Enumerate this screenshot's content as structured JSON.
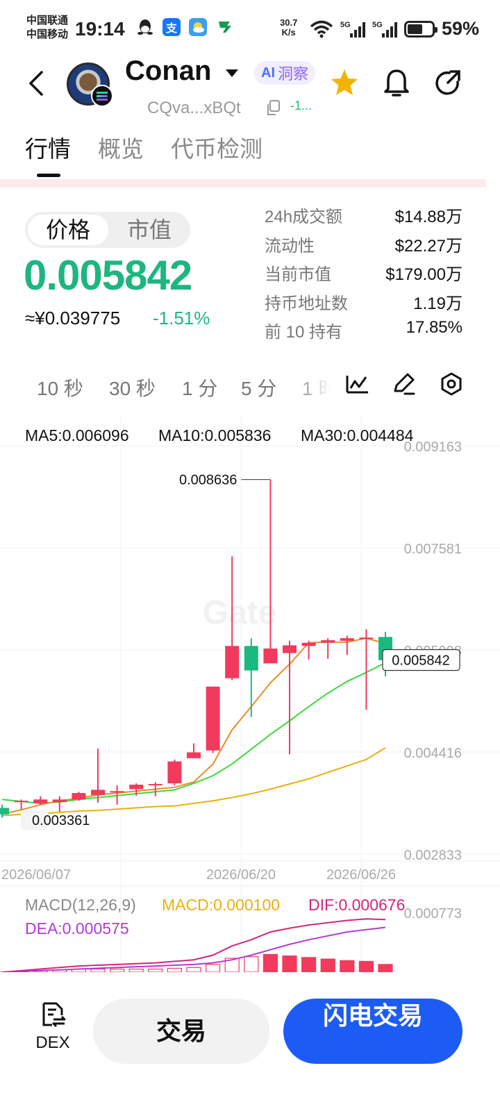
{
  "status_bar": {
    "carrier_1": "中国联通",
    "carrier_2": "中国移动",
    "time": "19:14",
    "net_speed_value": "30.7",
    "net_speed_unit": "K/s",
    "battery": "59%",
    "battery_level": 0.59
  },
  "header": {
    "coin_name": "Conan",
    "ai_tag": "洞察",
    "ai_prefix": "AI",
    "address": "CQva...xBQt",
    "address_change": "-1...",
    "favorite_color": "#f5b301"
  },
  "tabs": [
    "行情",
    "概览",
    "代币检测"
  ],
  "price_panel": {
    "toggle": [
      "价格",
      "市值"
    ],
    "price": "0.005842",
    "cny_price": "≈¥0.039775",
    "change_pct": "-1.51%",
    "stats": [
      {
        "label": "24h成交额",
        "value": "$14.88万"
      },
      {
        "label": "流动性",
        "value": "$22.27万"
      },
      {
        "label": "当前市值",
        "value": "$179.00万"
      },
      {
        "label": "持币地址数",
        "value": "1.19万"
      },
      {
        "label": "前 10 持有",
        "value": "17.85%"
      }
    ]
  },
  "intervals": [
    "10 秒",
    "30 秒",
    "1 分",
    "5 分",
    "1 时"
  ],
  "chart": {
    "ma5": "MA5:0.006096",
    "ma10": "MA10:0.005836",
    "ma30": "MA30:0.004484",
    "watermark": "Gate",
    "high_label": "0.008636",
    "low_label": "0.003361",
    "current_label": "0.005842",
    "colors": {
      "up": "#f23a5d",
      "down": "#1ab980",
      "ma5": "#f08a24",
      "ma10": "#3ed93c",
      "ma30": "#e8b012"
    }
  },
  "chart_data": {
    "type": "candlestick",
    "price_axis": {
      "ticks": [
        "0.009163",
        "0.007581",
        "0.005998",
        "0.004416",
        "0.002833"
      ],
      "range": [
        0.002833,
        0.009163
      ]
    },
    "x_tick_labels": [
      "2026/06/07",
      "2026/06/20",
      "2026/06/26"
    ],
    "candles": [
      {
        "o": 0.00355,
        "c": 0.00345,
        "h": 0.0036,
        "l": 0.0034
      },
      {
        "o": 0.00364,
        "c": 0.00366,
        "h": 0.00368,
        "l": 0.00352
      },
      {
        "o": 0.00362,
        "c": 0.00368,
        "h": 0.00373,
        "l": 0.0036
      },
      {
        "o": 0.00364,
        "c": 0.00368,
        "h": 0.00373,
        "l": 0.00349
      },
      {
        "o": 0.00368,
        "c": 0.00378,
        "h": 0.0038,
        "l": 0.00366
      },
      {
        "o": 0.00375,
        "c": 0.00383,
        "h": 0.00447,
        "l": 0.00363
      },
      {
        "o": 0.0038,
        "c": 0.00381,
        "h": 0.0039,
        "l": 0.0036
      },
      {
        "o": 0.00384,
        "c": 0.00391,
        "h": 0.00393,
        "l": 0.00374
      },
      {
        "o": 0.00391,
        "c": 0.00392,
        "h": 0.00395,
        "l": 0.00373
      },
      {
        "o": 0.00393,
        "c": 0.00427,
        "h": 0.0043,
        "l": 0.0039
      },
      {
        "o": 0.00432,
        "c": 0.00441,
        "h": 0.00455,
        "l": 0.00432
      },
      {
        "o": 0.00444,
        "c": 0.00543,
        "h": 0.00543,
        "l": 0.0044
      },
      {
        "o": 0.00556,
        "c": 0.00606,
        "h": 0.00745,
        "l": 0.00553
      },
      {
        "o": 0.00606,
        "c": 0.00568,
        "h": 0.00618,
        "l": 0.00496
      },
      {
        "o": 0.00579,
        "c": 0.00602,
        "h": 0.00864,
        "l": 0.00579
      },
      {
        "o": 0.00595,
        "c": 0.00607,
        "h": 0.00614,
        "l": 0.00438
      },
      {
        "o": 0.00606,
        "c": 0.00611,
        "h": 0.00614,
        "l": 0.00585
      },
      {
        "o": 0.00611,
        "c": 0.00615,
        "h": 0.00618,
        "l": 0.00586
      },
      {
        "o": 0.00614,
        "c": 0.00618,
        "h": 0.00622,
        "l": 0.00592
      },
      {
        "o": 0.00617,
        "c": 0.00619,
        "h": 0.00632,
        "l": 0.00507
      },
      {
        "o": 0.0062,
        "c": 0.00584,
        "h": 0.00628,
        "l": 0.00559
      }
    ],
    "ma5": [
      0.00345,
      0.00352,
      0.0036,
      0.00366,
      0.0037,
      0.00375,
      0.00378,
      0.00381,
      0.00384,
      0.00387,
      0.00395,
      0.00423,
      0.00476,
      0.00512,
      0.00549,
      0.00578,
      0.00611,
      0.00612,
      0.00612,
      0.00618,
      0.0061
    ],
    "ma10": [
      0.00368,
      0.00365,
      0.00362,
      0.00364,
      0.00368,
      0.00371,
      0.00374,
      0.00377,
      0.0038,
      0.00383,
      0.00393,
      0.00405,
      0.00423,
      0.00446,
      0.00469,
      0.0049,
      0.00512,
      0.00533,
      0.00551,
      0.00565,
      0.0058
    ],
    "ma30": [
      0.00343,
      0.00345,
      0.00346,
      0.00348,
      0.0035,
      0.00351,
      0.00353,
      0.00355,
      0.00357,
      0.00358,
      0.00362,
      0.00366,
      0.00371,
      0.00377,
      0.00384,
      0.00392,
      0.004,
      0.0041,
      0.0042,
      0.0043,
      0.00448
    ],
    "macd_panel": {
      "title": "MACD(12,26,9)",
      "macd": "MACD:0.000100",
      "dif": "DIF:0.000676",
      "dea": "DEA:0.000575",
      "axis_top": "0.000773",
      "dif_values": [
        0.0,
        2e-05,
        4e-05,
        6e-05,
        8e-05,
        9e-05,
        0.0001,
        0.00011,
        0.00012,
        0.00014,
        0.00016,
        0.00022,
        0.00034,
        0.00042,
        0.00052,
        0.00057,
        0.00061,
        0.00064,
        0.00067,
        0.00069,
        0.00068
      ],
      "dea_values": [
        0.0,
        1e-05,
        2e-05,
        3e-05,
        4e-05,
        5e-05,
        6e-05,
        7e-05,
        8e-05,
        9e-05,
        0.0001,
        0.00012,
        0.00016,
        0.00022,
        0.00029,
        0.00036,
        0.00042,
        0.00047,
        0.00052,
        0.00055,
        0.00058
      ],
      "histogram": [
        0.0,
        1e-05,
        2e-05,
        3e-05,
        4e-05,
        4e-05,
        4e-05,
        4e-05,
        4e-05,
        5e-05,
        6e-05,
        0.0001,
        0.00018,
        0.0002,
        0.00023,
        0.00021,
        0.00019,
        0.00017,
        0.00015,
        0.00014,
        0.0001
      ]
    }
  },
  "bottom_bar": {
    "dex_label": "DEX",
    "trade": "交易",
    "flash_trade": "闪电交易"
  }
}
